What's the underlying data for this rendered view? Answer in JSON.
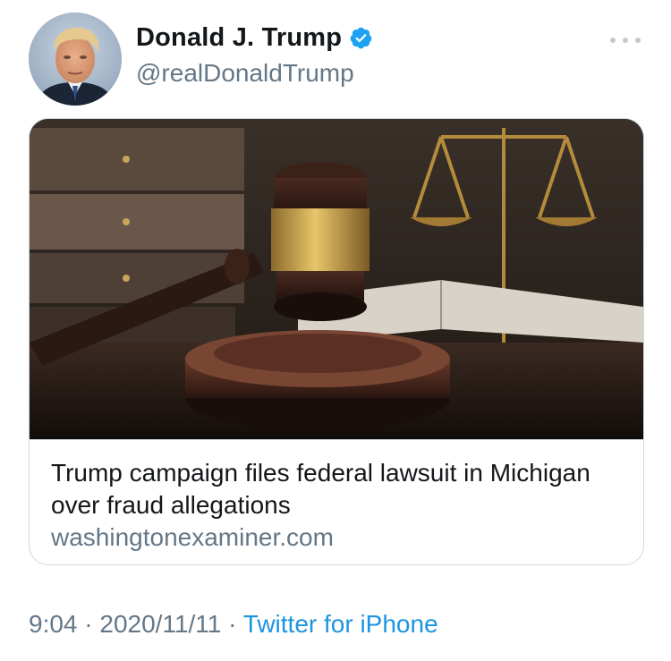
{
  "author": {
    "display_name": "Donald J. Trump",
    "handle": "@realDonaldTrump",
    "verified": true
  },
  "menu": {
    "icon": "more-horizontal-icon"
  },
  "link_card": {
    "title": "Trump campaign files federal lawsuit in Michigan over fraud allegations",
    "domain": "washingtonexaminer.com",
    "image_subject": "gavel-and-scales-image"
  },
  "meta": {
    "time": "9:04",
    "separator_1": " · ",
    "date": "2020/11/11",
    "separator_2": " · ",
    "source": "Twitter for iPhone"
  },
  "colors": {
    "text_primary": "#14171a",
    "text_secondary": "#657786",
    "link_blue": "#1b95e0",
    "verified_blue": "#1da1f2",
    "border": "#cfd9de"
  }
}
